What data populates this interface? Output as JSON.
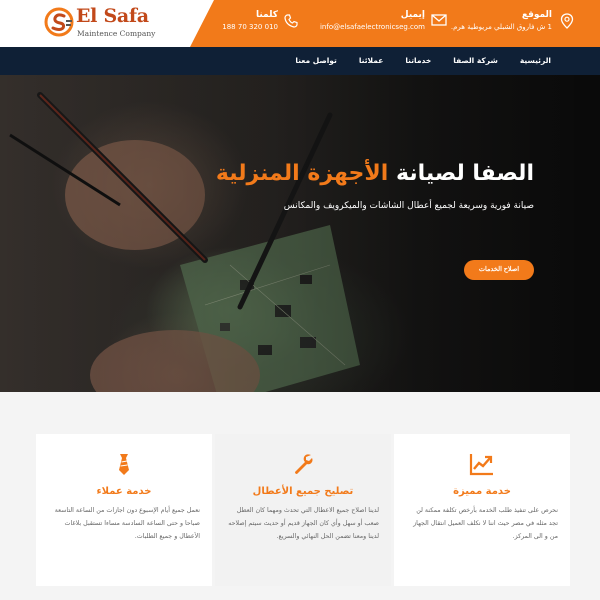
{
  "logo": {
    "brand_el": "El",
    "brand_safa": "Safa",
    "tagline": "Maintence Company"
  },
  "topbar": {
    "location": {
      "title": "الموقع",
      "value": "1 ش فاروق الشبلي مريوطية هرم.",
      "icon": "location-pin-icon"
    },
    "email": {
      "title": "إيميل",
      "value": "info@elsafaelectronicseg.com",
      "icon": "envelope-icon"
    },
    "phone": {
      "title": "كلمنا",
      "value": "010 320 70 188",
      "icon": "phone-icon"
    }
  },
  "nav": {
    "items": [
      "الرئيسية",
      "شركة الصفا",
      "خدماتنا",
      "عملائنا",
      "تواصل معنا"
    ]
  },
  "hero": {
    "title_part1": "الصفا لصيانة ",
    "title_highlight": "الأجهزة المنزلية",
    "subtitle": "صيانة فورية وسريعة لجميع أعطال الشاشات والميكرويف والمكانس",
    "button": "اصلاح الخدمات"
  },
  "features": [
    {
      "title": "خدمة مميزة",
      "text": "نحرص على تنفيذ طلب الخدمة بأرخص تكلفة ممكنة لن تجد مثله في مصر حيث اننا لا نكلف العميل انتقال الجهاز من و الى المركز.",
      "icon": "trend-chart-icon"
    },
    {
      "title": "تصليح جميع الأعطال",
      "text": "لدينا اصلاح جميع الاعطال التي تحدث ومهما كان العطل صعب أو سهل وأي كان الجهاز قديم أو حديث سيتم إصلاحه لدينا ومعنا تضمن الحل النهائي والسريع.",
      "icon": "wrench-icon"
    },
    {
      "title": "خدمة عملاء",
      "text": "نعمل جميع أيام الإسبوع دون اجازات من الساعة التاسعة صباحا و حتى الساعة السادسة مساءا تستقبل بلاغات الأعطال و جميع الطلبات.",
      "icon": "necktie-icon"
    }
  ],
  "colors": {
    "accent": "#f27a1a",
    "nav_bg": "#0f2036",
    "card_text": "#666666"
  }
}
